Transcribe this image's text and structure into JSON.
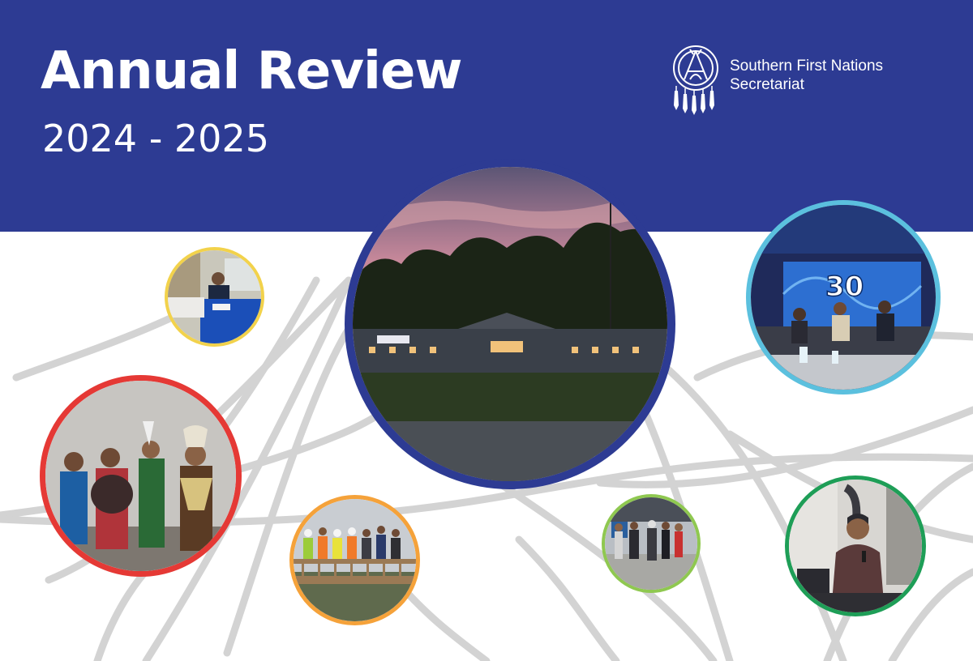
{
  "header": {
    "title": "Annual Review",
    "subtitle": "2024 - 2025",
    "background_color": "#2d3b93"
  },
  "logo": {
    "icon": "dreamcatcher-teepee-logo-icon",
    "org_name_line1": "Southern First Nations",
    "org_name_line2": "Secretariat"
  },
  "photos": [
    {
      "name": "photo-office-building-sunset",
      "border_color": "#2d3b93"
    },
    {
      "name": "photo-info-booth",
      "border_color": "#f2d24b"
    },
    {
      "name": "photo-regalia-dancers",
      "border_color": "#e53935"
    },
    {
      "name": "photo-construction-deck-group",
      "border_color": "#f5a23a"
    },
    {
      "name": "photo-30th-anniversary-stage",
      "border_color": "#5bc0de",
      "sign_text": "30"
    },
    {
      "name": "photo-outdoor-gathering",
      "border_color": "#8fc850"
    },
    {
      "name": "photo-speaker-microphone",
      "border_color": "#1e9e57"
    }
  ]
}
